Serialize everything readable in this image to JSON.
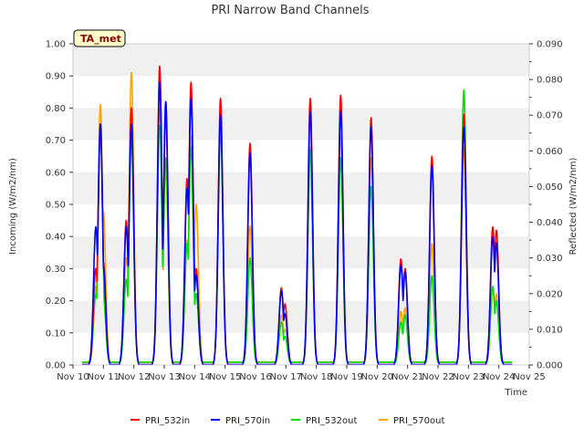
{
  "chart_data": {
    "type": "line",
    "title": "PRI Narrow Band Channels",
    "xlabel": "Time",
    "ylabel": "Incoming (W/m2/nm)",
    "y2label": "Reflected (W/m2/nm)",
    "badge": "TA_met",
    "xlim": [
      10,
      25
    ],
    "ylim": [
      0,
      1.0
    ],
    "y2lim": [
      0,
      0.09
    ],
    "x_ticks": [
      10,
      11,
      12,
      13,
      14,
      15,
      16,
      17,
      18,
      19,
      20,
      21,
      22,
      23,
      24,
      25
    ],
    "x_tick_labels": [
      "Nov 10",
      "Nov 11",
      "Nov 12",
      "Nov 13",
      "Nov 14",
      "Nov 15",
      "Nov 16",
      "Nov 17",
      "Nov 18",
      "Nov 19",
      "Nov 20",
      "Nov 21",
      "Nov 22",
      "Nov 23",
      "Nov 24",
      "Nov 25"
    ],
    "y_ticks": [
      0,
      0.1,
      0.2,
      0.3,
      0.4,
      0.5,
      0.6,
      0.7,
      0.8,
      0.9,
      1.0
    ],
    "y_tick_labels": [
      "0.00",
      "0.10",
      "0.20",
      "0.30",
      "0.40",
      "0.50",
      "0.60",
      "0.70",
      "0.80",
      "0.90",
      "1.00"
    ],
    "y2_ticks": [
      0,
      0.01,
      0.02,
      0.03,
      0.04,
      0.05,
      0.06,
      0.07,
      0.08,
      0.09
    ],
    "y2_tick_labels": [
      "0.000",
      "0.010",
      "0.020",
      "0.030",
      "0.040",
      "0.050",
      "0.060",
      "0.070",
      "0.080",
      "0.090"
    ],
    "grid": "horizontal bands",
    "legend": "bottom",
    "series": [
      {
        "name": "PRI_532in",
        "color": "#ff0000",
        "axis": "left",
        "peaks": [
          [
            10.75,
            0.3
          ],
          [
            10.9,
            0.75
          ],
          [
            11.0,
            0.32
          ],
          [
            11.75,
            0.45
          ],
          [
            11.92,
            0.8
          ],
          [
            12.85,
            0.93
          ],
          [
            13.05,
            0.78
          ],
          [
            13.75,
            0.58
          ],
          [
            13.88,
            0.88
          ],
          [
            14.05,
            0.3
          ],
          [
            14.85,
            0.83
          ],
          [
            15.82,
            0.69
          ],
          [
            16.85,
            0.24
          ],
          [
            16.97,
            0.19
          ],
          [
            17.8,
            0.83
          ],
          [
            18.8,
            0.84
          ],
          [
            19.8,
            0.77
          ],
          [
            20.78,
            0.33
          ],
          [
            20.92,
            0.3
          ],
          [
            21.8,
            0.65
          ],
          [
            22.85,
            0.78
          ],
          [
            23.8,
            0.43
          ],
          [
            23.92,
            0.42
          ]
        ]
      },
      {
        "name": "PRI_570in",
        "color": "#0000ff",
        "axis": "left",
        "peaks": [
          [
            10.75,
            0.43
          ],
          [
            10.9,
            0.75
          ],
          [
            11.0,
            0.3
          ],
          [
            11.75,
            0.43
          ],
          [
            11.92,
            0.75
          ],
          [
            12.85,
            0.88
          ],
          [
            13.05,
            0.82
          ],
          [
            13.75,
            0.55
          ],
          [
            13.88,
            0.83
          ],
          [
            14.05,
            0.28
          ],
          [
            14.85,
            0.78
          ],
          [
            15.82,
            0.66
          ],
          [
            16.85,
            0.23
          ],
          [
            16.97,
            0.16
          ],
          [
            17.8,
            0.79
          ],
          [
            18.8,
            0.79
          ],
          [
            19.8,
            0.74
          ],
          [
            20.78,
            0.31
          ],
          [
            20.92,
            0.29
          ],
          [
            21.8,
            0.62
          ],
          [
            22.85,
            0.74
          ],
          [
            23.8,
            0.4
          ],
          [
            23.92,
            0.38
          ]
        ]
      },
      {
        "name": "PRI_532out",
        "color": "#00dd00",
        "axis": "right",
        "peaks": [
          [
            10.75,
            0.02
          ],
          [
            10.9,
            0.067
          ],
          [
            11.0,
            0.019
          ],
          [
            11.75,
            0.024
          ],
          [
            11.92,
            0.064
          ],
          [
            12.85,
            0.067
          ],
          [
            13.05,
            0.058
          ],
          [
            13.75,
            0.034
          ],
          [
            13.88,
            0.061
          ],
          [
            14.05,
            0.02
          ],
          [
            14.85,
            0.066
          ],
          [
            15.82,
            0.03
          ],
          [
            16.85,
            0.012
          ],
          [
            16.97,
            0.008
          ],
          [
            17.8,
            0.06
          ],
          [
            18.8,
            0.058
          ],
          [
            19.8,
            0.05
          ],
          [
            20.78,
            0.012
          ],
          [
            20.92,
            0.014
          ],
          [
            21.8,
            0.025
          ],
          [
            22.85,
            0.077
          ],
          [
            23.8,
            0.022
          ],
          [
            23.92,
            0.018
          ]
        ]
      },
      {
        "name": "PRI_570out",
        "color": "#ffa500",
        "axis": "right",
        "peaks": [
          [
            10.75,
            0.022
          ],
          [
            10.9,
            0.073
          ],
          [
            11.0,
            0.043
          ],
          [
            11.75,
            0.03
          ],
          [
            11.92,
            0.082
          ],
          [
            12.85,
            0.072
          ],
          [
            13.05,
            0.055
          ],
          [
            13.75,
            0.035
          ],
          [
            13.88,
            0.064
          ],
          [
            14.05,
            0.045
          ],
          [
            14.85,
            0.07
          ],
          [
            15.82,
            0.039
          ],
          [
            16.85,
            0.014
          ],
          [
            16.97,
            0.01
          ],
          [
            17.8,
            0.061
          ],
          [
            18.8,
            0.064
          ],
          [
            19.8,
            0.058
          ],
          [
            20.78,
            0.015
          ],
          [
            20.92,
            0.016
          ],
          [
            21.8,
            0.034
          ],
          [
            22.85,
            0.061
          ],
          [
            23.8,
            0.022
          ],
          [
            23.92,
            0.02
          ]
        ]
      }
    ]
  }
}
